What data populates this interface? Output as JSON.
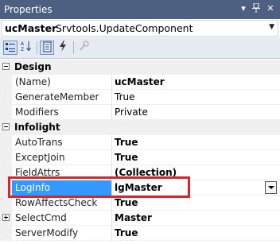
{
  "window": {
    "title": "Properties"
  },
  "object_selector": {
    "name": "ucMaster",
    "type": "Srvtools.UpdateComponent"
  },
  "toolbar": {
    "categorized_tooltip": "Categorized",
    "alphabetical_tooltip": "Alphabetical",
    "properties_tooltip": "Properties",
    "events_tooltip": "Events",
    "property_pages_tooltip": "Property Pages"
  },
  "rows": [
    {
      "kind": "category",
      "name": "Design",
      "expanded": true
    },
    {
      "kind": "prop",
      "name": "(Name)",
      "value": "ucMaster",
      "bold": true
    },
    {
      "kind": "prop",
      "name": "GenerateMember",
      "value": "True",
      "bold": false
    },
    {
      "kind": "prop",
      "name": "Modifiers",
      "value": "Private",
      "bold": false
    },
    {
      "kind": "category",
      "name": "Infolight",
      "expanded": true
    },
    {
      "kind": "prop",
      "name": "AutoTrans",
      "value": "True",
      "bold": true
    },
    {
      "kind": "prop",
      "name": "ExceptJoin",
      "value": "True",
      "bold": true
    },
    {
      "kind": "prop",
      "name": "FieldAttrs",
      "value": "(Collection)",
      "bold": true
    },
    {
      "kind": "prop",
      "name": "LogInfo",
      "value": "lgMaster",
      "bold": true,
      "selected": true
    },
    {
      "kind": "prop",
      "name": "RowAffectsCheck",
      "value": "True",
      "bold": true
    },
    {
      "kind": "prop",
      "name": "SelectCmd",
      "value": "Master",
      "bold": true,
      "expandable": true
    },
    {
      "kind": "prop",
      "name": "ServerModify",
      "value": "True",
      "bold": true
    }
  ],
  "colors": {
    "title_bar": "#4d6082",
    "selection": "#3399ff",
    "highlight_box": "#d9262c"
  }
}
